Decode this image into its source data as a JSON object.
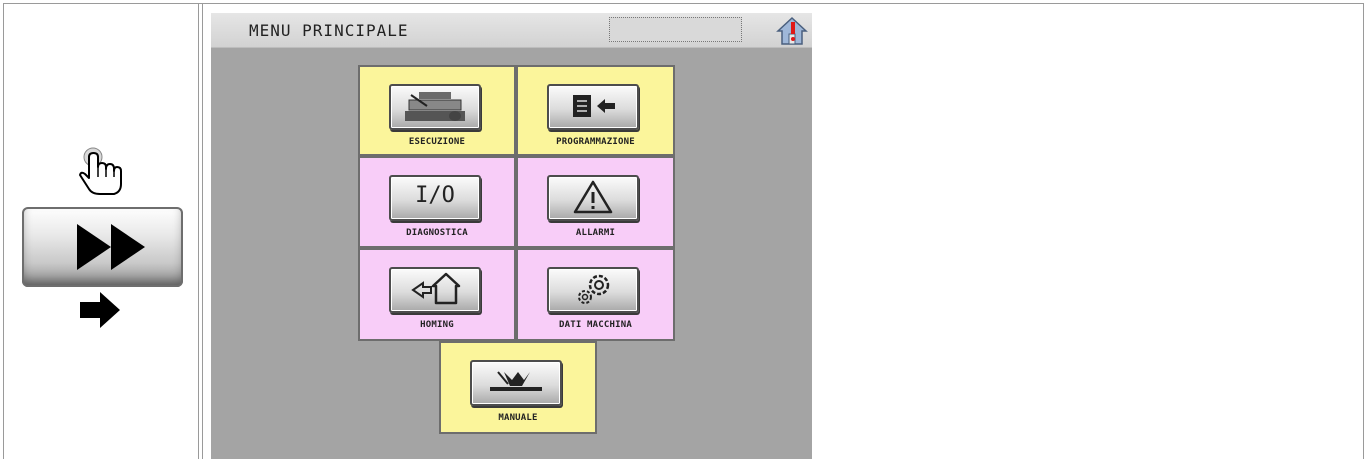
{
  "screen": {
    "title": "MENU PRINCIPALE"
  },
  "menu": {
    "items": [
      {
        "label": "ESECUZIONE",
        "icon": "machine-execution-icon",
        "color": "#fbf59b"
      },
      {
        "label": "PROGRAMMAZIONE",
        "icon": "program-input-icon",
        "color": "#fbf59b"
      },
      {
        "label": "DIAGNOSTICA",
        "icon": "io-icon",
        "icon_text": "I/O",
        "color": "#f8cdf8"
      },
      {
        "label": "ALLARMI",
        "icon": "warning-icon",
        "color": "#f8cdf8"
      },
      {
        "label": "HOMING",
        "icon": "homing-icon",
        "color": "#f8cdf8"
      },
      {
        "label": "DATI MACCHINA",
        "icon": "gears-icon",
        "color": "#f8cdf8"
      },
      {
        "label": "MANUALE",
        "icon": "manual-tool-icon",
        "color": "#fbf59b"
      }
    ]
  },
  "colors": {
    "screen_bg": "#a4a4a4",
    "tile_yellow": "#fbf59b",
    "tile_pink": "#f8cdf8"
  }
}
